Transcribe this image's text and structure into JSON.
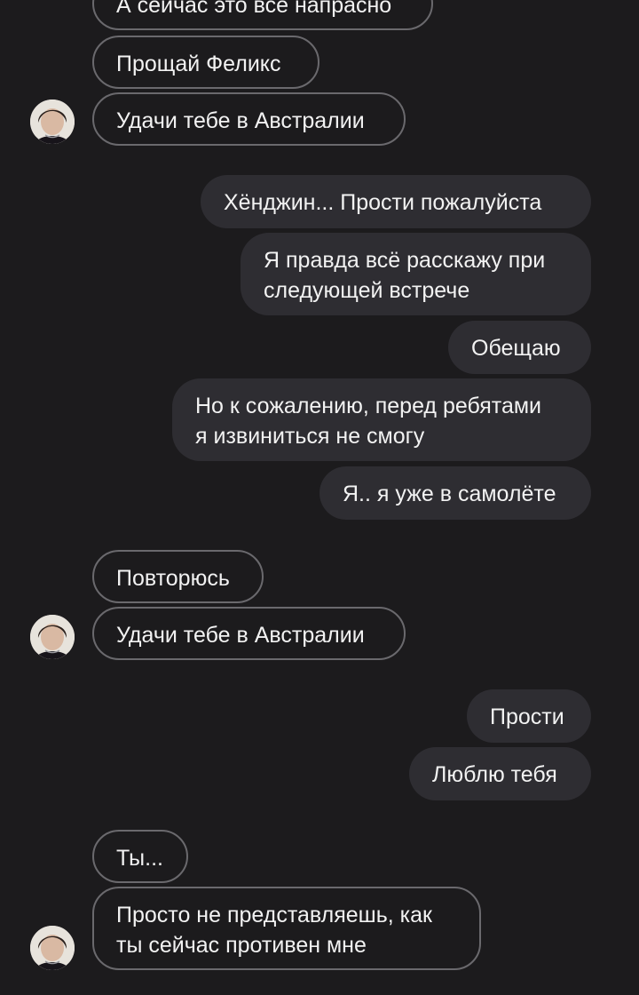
{
  "messages": [
    {
      "side": "in",
      "text": "А сейчас это все напрасно"
    },
    {
      "side": "in",
      "text": "Прощай Феликс"
    },
    {
      "side": "in",
      "text": "Удачи тебе в Австралии"
    },
    {
      "side": "out",
      "text": "Хёнджин... Прости пожалуйста"
    },
    {
      "side": "out",
      "text": "Я правда всё расскажу при\nследующей встрече"
    },
    {
      "side": "out",
      "text": "Обещаю"
    },
    {
      "side": "out",
      "text": "Но к сожалению, перед ребятами\nя извиниться не смогу"
    },
    {
      "side": "out",
      "text": "Я.. я уже в самолёте"
    },
    {
      "side": "in",
      "text": "Повторюсь"
    },
    {
      "side": "in",
      "text": "Удачи тебе в Австралии"
    },
    {
      "side": "out",
      "text": "Прости"
    },
    {
      "side": "out",
      "text": "Люблю тебя"
    },
    {
      "side": "in",
      "text": "Ты..."
    },
    {
      "side": "in",
      "text": "Просто не представляешь, как\nты сейчас противен мне"
    }
  ],
  "avatar_icon": "contact-avatar",
  "colors": {
    "background": "#1c1b1d",
    "outgoing_bubble": "#2e2d32",
    "incoming_border": "#6a696d",
    "text": "#f2f2f2"
  }
}
